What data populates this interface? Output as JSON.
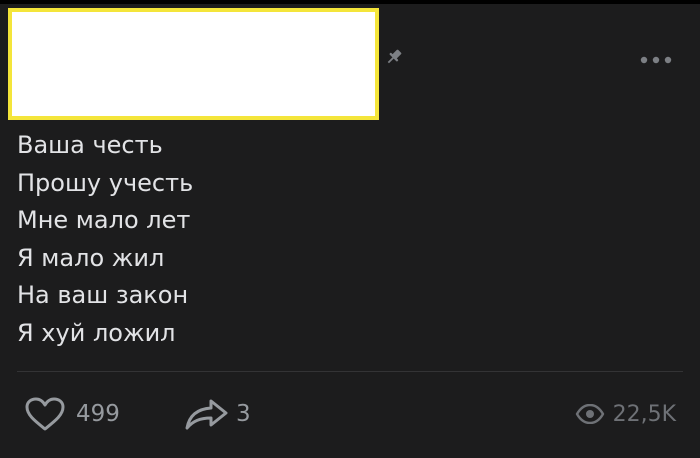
{
  "post": {
    "lines": [
      "Ваша честь",
      "Прошу учесть",
      "Мне мало лет",
      "Я мало жил",
      "На ваш закон",
      "Я хуй ложил"
    ]
  },
  "footer": {
    "likes": "499",
    "shares": "3",
    "views": "22,5K"
  },
  "icons": {
    "pin": "pin-icon",
    "more": "more-horizontal-icon",
    "like": "heart-icon",
    "share": "share-arrow-icon",
    "views": "eye-icon"
  },
  "colors": {
    "background": "#1c1c1d",
    "text": "#e2e3e6",
    "muted": "#969a9f",
    "redaction_fill": "#ffffff",
    "redaction_border": "#f4e53a"
  }
}
